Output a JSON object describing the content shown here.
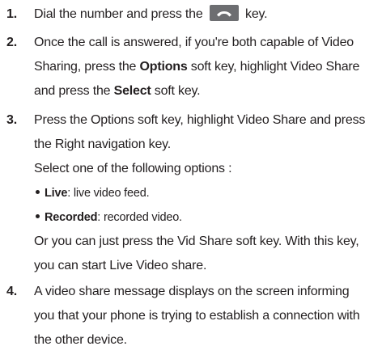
{
  "steps": [
    {
      "num": "1.",
      "pre": "Dial the number and press the",
      "icon": "send-key-icon",
      "post": "key."
    },
    {
      "num": "2.",
      "l1": "Once the call is answered, if you're both capable of Video",
      "l2_a": "Sharing, press the ",
      "l2_b": "Options",
      "l2_c": " soft key, highlight Video Share",
      "l3_a": "and press the ",
      "l3_b": "Select",
      "l3_c": " soft key."
    },
    {
      "num": "3.",
      "l1": "Press the Options soft key, highlight Video Share and press",
      "l2": "the Right navigation key.",
      "l3": "Select one of the following options :",
      "bullets": [
        {
          "term": "Live",
          "desc": ": live video feed."
        },
        {
          "term": "Recorded",
          "desc": ": recorded video."
        }
      ],
      "l4": "Or you can just press the Vid Share soft key. With this key,",
      "l5": "you can start Live Video share."
    },
    {
      "num": "4.",
      "l1": "A video share message displays on the screen informing",
      "l2": "you that your phone is trying to establish a connection with",
      "l3": "the other device."
    }
  ],
  "colors": {
    "text": "#231f20",
    "icon_bg": "#6d6e71",
    "icon_fg": "#ffffff"
  }
}
